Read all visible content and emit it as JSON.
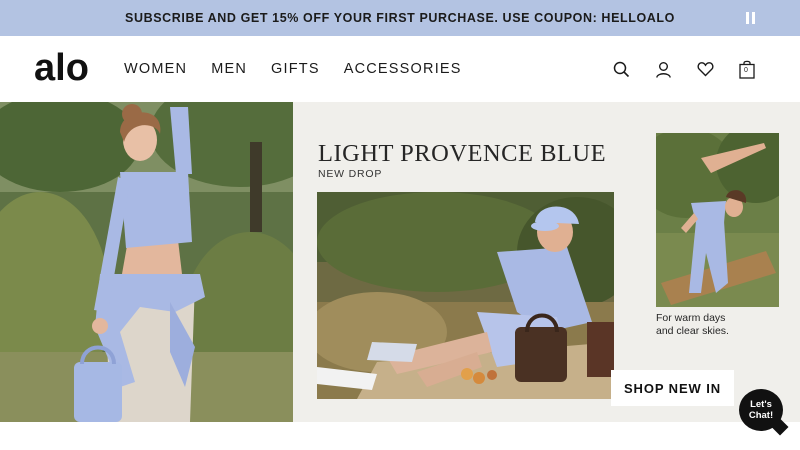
{
  "announcement": {
    "text": "SUBSCRIBE AND GET 15% OFF YOUR FIRST PURCHASE. USE COUPON: HELLOALO",
    "pause_icon": "pause-icon"
  },
  "header": {
    "logo_text": "alo",
    "nav": [
      {
        "label": "WOMEN"
      },
      {
        "label": "MEN"
      },
      {
        "label": "GIFTS"
      },
      {
        "label": "ACCESSORIES"
      }
    ],
    "icons": [
      "search-icon",
      "account-icon",
      "wishlist-heart-icon",
      "cart-bag-icon"
    ],
    "cart_count": "0"
  },
  "hero": {
    "title": "LIGHT PROVENCE BLUE",
    "subtitle": "NEW DROP",
    "caption_line1": "For warm days",
    "caption_line2": "and clear skies.",
    "cta_label": "SHOP NEW IN"
  },
  "chat": {
    "line1": "Let's",
    "line2": "Chat!"
  },
  "colors": {
    "announcement_bg": "#b3c3e2",
    "hero_bg": "#f0efeb",
    "outfit_blue": "#a9b9e4",
    "text": "#1b1b1b"
  }
}
